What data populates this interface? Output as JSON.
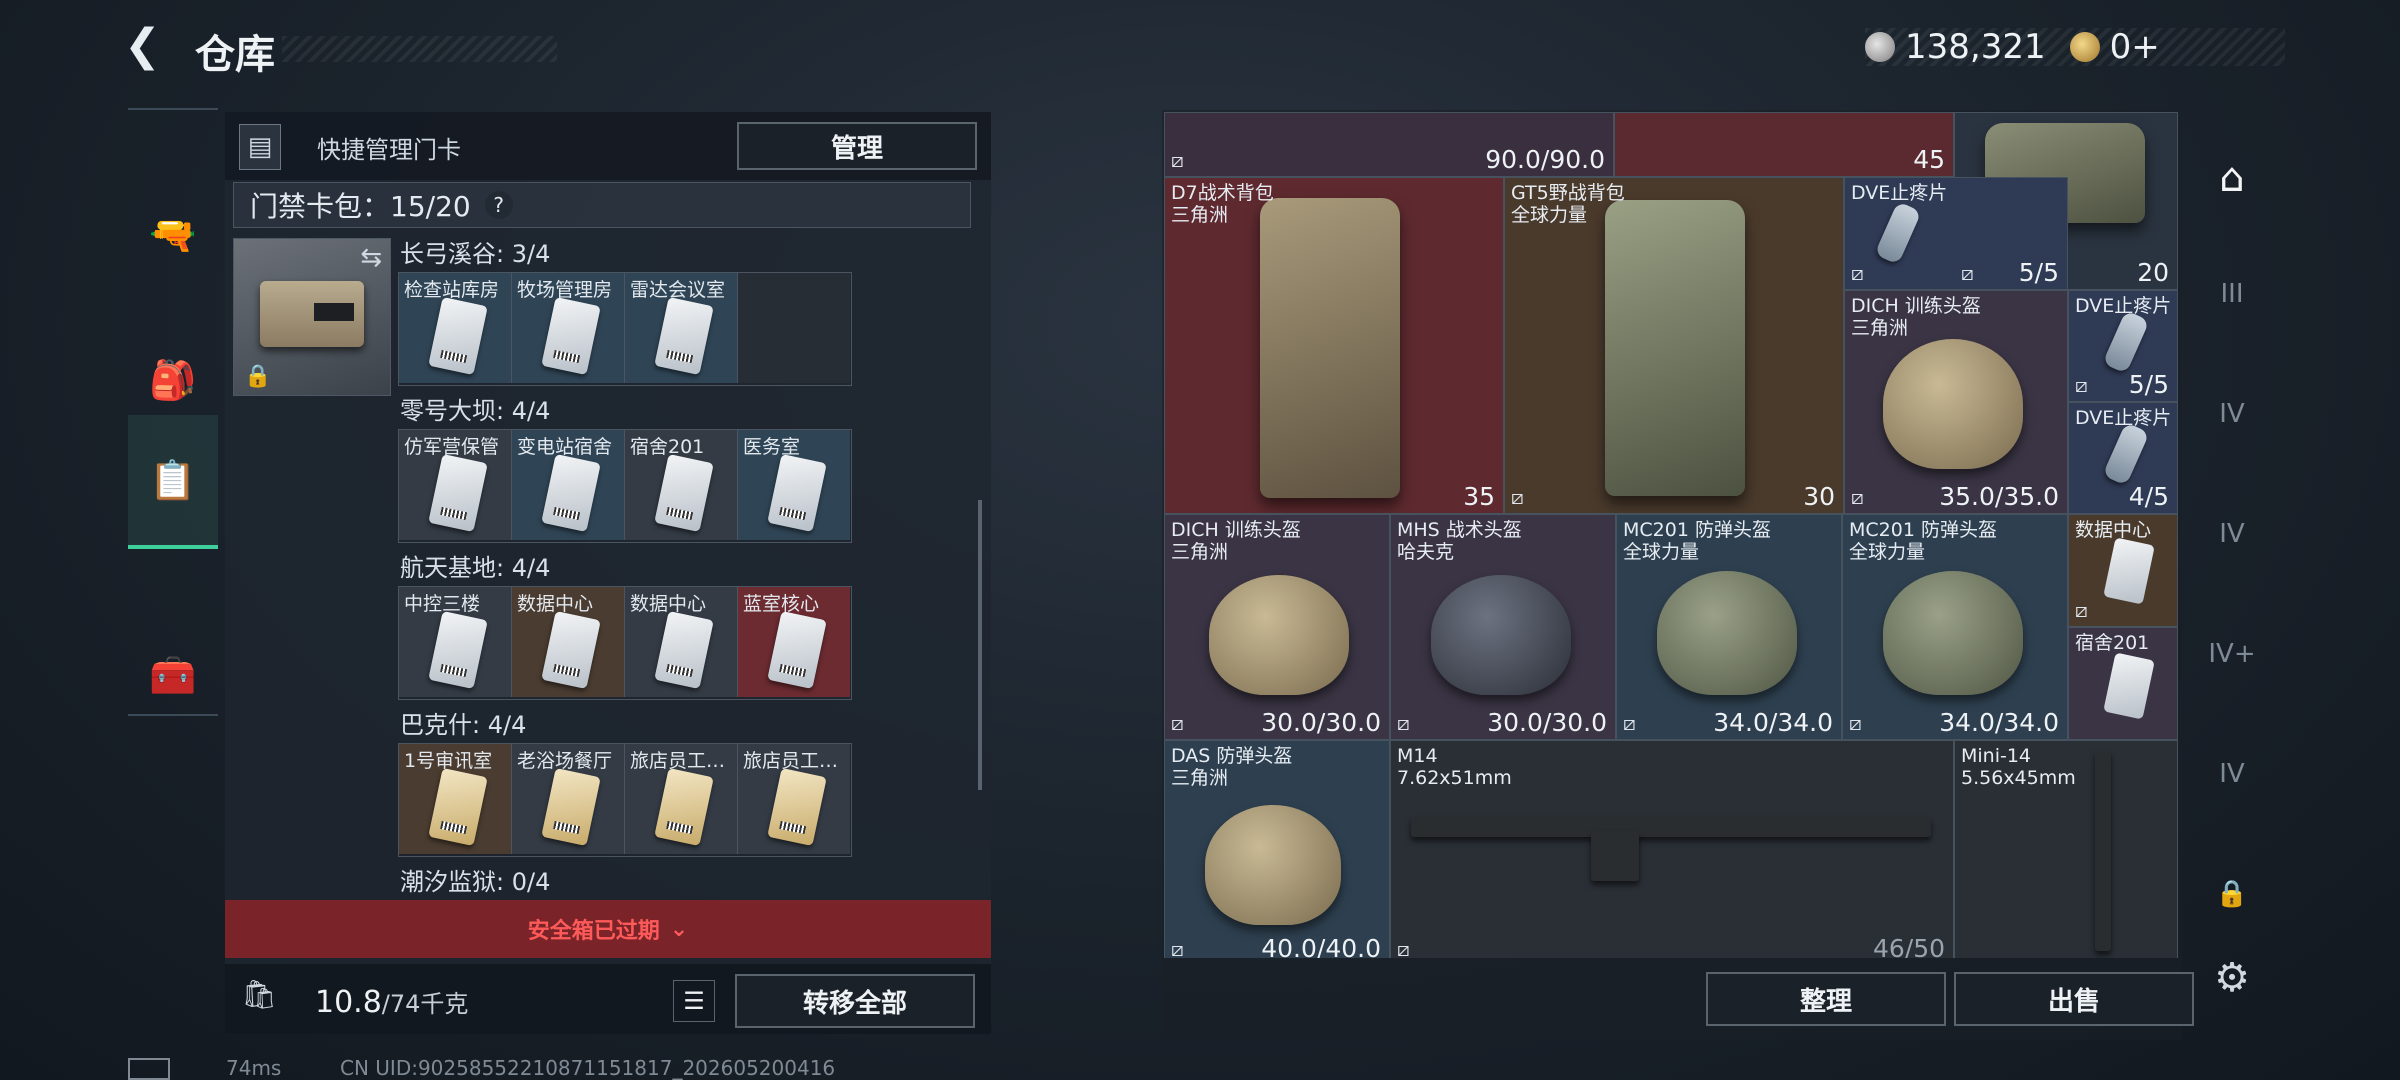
{
  "header": {
    "title": "仓库",
    "silver": "138,321",
    "gold": "0+"
  },
  "left_tabs": [
    "weapon-tab",
    "gear-tab",
    "keycard-tab",
    "tools-tab"
  ],
  "keycard": {
    "label": "快捷管理门卡",
    "manage_btn": "管理",
    "wallet": "门禁卡包：15/20",
    "help": "?",
    "regions": [
      {
        "name": "长弓溪谷: 3/4",
        "slots": [
          {
            "name": "检查站库房",
            "bg": "blue"
          },
          {
            "name": "牧场管理房",
            "bg": "blue"
          },
          {
            "name": "雷达会议室",
            "bg": "blue"
          },
          {
            "name": "",
            "bg": "empty"
          }
        ]
      },
      {
        "name": "零号大坝: 4/4",
        "slots": [
          {
            "name": "仿军营保管",
            "bg": "gray"
          },
          {
            "name": "变电站宿舍",
            "bg": "blue"
          },
          {
            "name": "宿舍201",
            "bg": "gray"
          },
          {
            "name": "医务室",
            "bg": "blue"
          }
        ]
      },
      {
        "name": "航天基地: 4/4",
        "slots": [
          {
            "name": "中控三楼",
            "bg": "gray"
          },
          {
            "name": "数据中心",
            "bg": "brown"
          },
          {
            "name": "数据中心",
            "bg": "gray"
          },
          {
            "name": "蓝室核心",
            "bg": "red"
          }
        ]
      },
      {
        "name": "巴克什: 4/4",
        "slots": [
          {
            "name": "1号审讯室",
            "bg": "brown"
          },
          {
            "name": "老浴场餐厅",
            "bg": "gray"
          },
          {
            "name": "旅店员工…",
            "bg": "gray"
          },
          {
            "name": "旅店员工…",
            "bg": "gray"
          }
        ]
      },
      {
        "name": "潮汐监狱: 0/4",
        "slots": []
      }
    ],
    "expired": "安全箱已过期",
    "weight": "10.8",
    "weight_max": "/74千克",
    "transfer_btn": "转移全部"
  },
  "stash": {
    "items": [
      {
        "name": "",
        "value": "90.0/90.0",
        "bg": "#3a2f3e"
      },
      {
        "name": "",
        "value": "45",
        "bg": "#5a2a30"
      },
      {
        "name": "",
        "value": "20",
        "bg": "#2a3440"
      },
      {
        "name": "D7战术背包\n三角洲",
        "value": "35",
        "bg": "#5e2a2f"
      },
      {
        "name": "GT5野战背包\n全球力量",
        "value": "30",
        "bg": "#4a3a2c"
      },
      {
        "name": "DVE止疼片",
        "value": "5/5",
        "bg": "#2f3a55"
      },
      {
        "name": "DICH 训练头盔\n三角洲",
        "value": "35.0/35.0",
        "bg": "#3a3444"
      },
      {
        "name": "DVE止疼片",
        "value": "5/5",
        "bg": "#2f3a55"
      },
      {
        "name": "DVE止疼片",
        "value": "4/5",
        "bg": "#2f3a55"
      },
      {
        "name": "DICH 训练头盔\n三角洲",
        "value": "30.0/30.0",
        "bg": "#3a3444"
      },
      {
        "name": "MHS 战术头盔\n哈夫克",
        "value": "30.0/30.0",
        "bg": "#3a3444"
      },
      {
        "name": "MC201 防弹头盔\n全球力量",
        "value": "34.0/34.0",
        "bg": "#2e4050"
      },
      {
        "name": "MC201 防弹头盔\n全球力量",
        "value": "34.0/34.0",
        "bg": "#2e4050"
      },
      {
        "name": "数据中心",
        "value": "",
        "bg": "#4a3a2c"
      },
      {
        "name": "宿舍201",
        "value": "",
        "bg": "#3a3444"
      },
      {
        "name": "DAS 防弹头盔\n三角洲",
        "value": "40.0/40.0",
        "bg": "#2e4050"
      },
      {
        "name": "M14\n7.62x51mm",
        "value": "46/50",
        "bg": "#2a2f36"
      },
      {
        "name": "Mini-14\n5.56x45mm",
        "value": "",
        "bg": "#2a2f36"
      }
    ],
    "sort_btn": "整理",
    "sell_btn": "出售"
  },
  "footer": {
    "ping": "74ms",
    "uid": "CN UID:9025855221087115181​7_202605200416"
  }
}
